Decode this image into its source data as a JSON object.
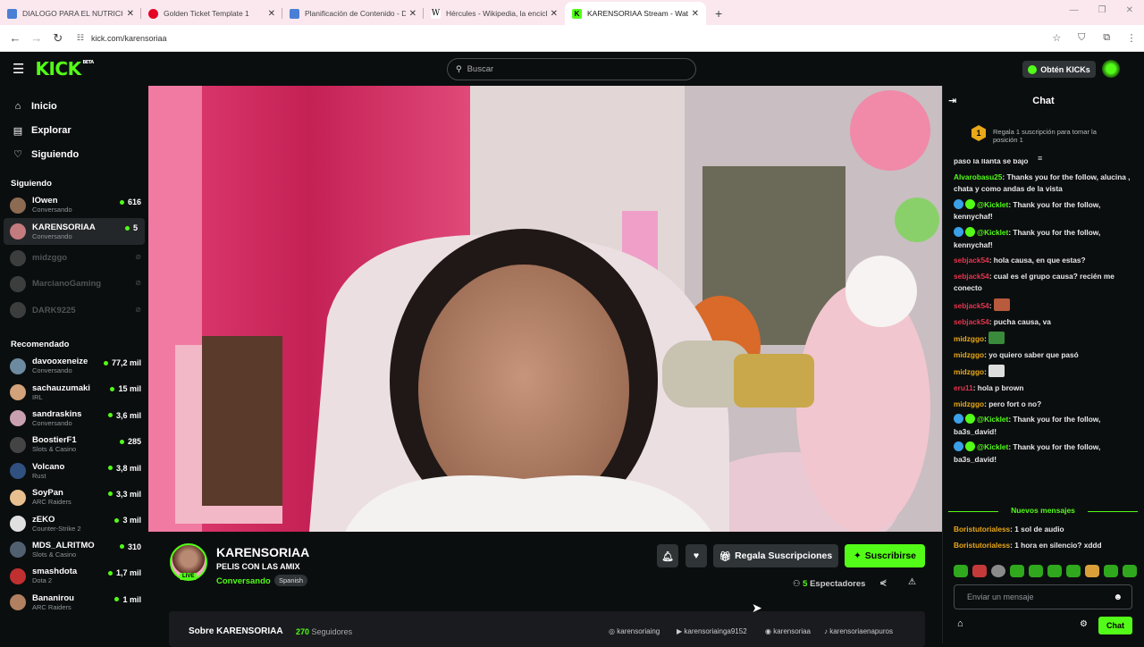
{
  "browser": {
    "tabs": [
      {
        "title": "DIALOGO PARA EL NUTRICION",
        "color": "#4a7fd6"
      },
      {
        "title": "Golden Ticket Template 1",
        "color": "#e60023"
      },
      {
        "title": "Planificación de Contenido - Di",
        "color": "#4a7fd6"
      },
      {
        "title": "Hércules - Wikipedia, la enciclo",
        "color": "#ffffff"
      },
      {
        "title": "KARENSORIAA Stream - Watch",
        "color": "#53fc18"
      }
    ],
    "url": "kick.com/karensoriaa"
  },
  "header": {
    "logo": "KICK",
    "logo_tag": "BETA",
    "search_placeholder": "Buscar",
    "get_kicks": "Obtén KICKs"
  },
  "sidebar": {
    "nav": [
      {
        "label": "Inicio"
      },
      {
        "label": "Explorar"
      },
      {
        "label": "Siguiendo"
      }
    ],
    "following_title": "Siguiendo",
    "following": [
      {
        "name": "lOwen",
        "category": "Conversando",
        "viewers": "616",
        "online": true
      },
      {
        "name": "KARENSORIAA",
        "category": "Conversando",
        "viewers": "5",
        "online": true
      },
      {
        "name": "midzggo",
        "category": "",
        "viewers": "",
        "online": false
      },
      {
        "name": "MarcianoGaming",
        "category": "",
        "viewers": "",
        "online": false
      },
      {
        "name": "DARK9225",
        "category": "",
        "viewers": "",
        "online": false
      }
    ],
    "recommended_title": "Recomendado",
    "recommended": [
      {
        "name": "davooxeneize",
        "category": "Conversando",
        "viewers": "77,2 mil"
      },
      {
        "name": "sachauzumaki",
        "category": "IRL",
        "viewers": "15 mil"
      },
      {
        "name": "sandraskins",
        "category": "Conversando",
        "viewers": "3,6 mil"
      },
      {
        "name": "BoostierF1",
        "category": "Slots & Casino",
        "viewers": "285"
      },
      {
        "name": "Volcano",
        "category": "Rust",
        "viewers": "3,8 mil"
      },
      {
        "name": "SoyPan",
        "category": "ARC Raiders",
        "viewers": "3,3 mil"
      },
      {
        "name": "zEKO",
        "category": "Counter-Strike 2",
        "viewers": "3 mil"
      },
      {
        "name": "MDS_ALRITMO",
        "category": "Slots & Casino",
        "viewers": "310"
      },
      {
        "name": "smashdota",
        "category": "Dota 2",
        "viewers": "1,7 mil"
      },
      {
        "name": "Bananirou",
        "category": "ARC Raiders",
        "viewers": "1 mil"
      }
    ]
  },
  "stream": {
    "name": "KARENSORIAA",
    "title": "PELIS CON LAS AMIX",
    "category": "Conversando",
    "language": "Spanish",
    "live": "LIVE",
    "gift_subs": "Regala Suscripciones",
    "subscribe": "Suscribirse",
    "viewers_count": "5",
    "viewers_label": "Espectadores",
    "about_title": "Sobre KARENSORIAA",
    "followers_count": "270",
    "followers_label": "Seguidores",
    "socials": [
      "karensoriaing",
      "karensoriainga9152",
      "karensoriaa",
      "karensoriaenapuros"
    ]
  },
  "chat": {
    "title": "Chat",
    "pinned": "Regala 1 suscripción para tomar la posición 1",
    "pinned_rank": "1",
    "messages": [
      {
        "user": "",
        "color": "#e8e8e8",
        "text": "paso la llanta se bajo"
      },
      {
        "user": "Alvarobasu25",
        "color": "#53fc18",
        "text": "Thanks you for the follow, alucina , chata y como andas de la vista"
      },
      {
        "user": "@Kicklet",
        "color": "#53fc18",
        "text": "Thank you for the follow, kennychaf!",
        "bot": true
      },
      {
        "user": "@Kicklet",
        "color": "#53fc18",
        "text": "Thank you for the follow, kennychaf!",
        "bot": true
      },
      {
        "user": "sebjack54",
        "color": "#e8344d",
        "text": "hola causa, en que estas?"
      },
      {
        "user": "sebjack54",
        "color": "#e8344d",
        "text": "cual es el grupo causa? recién me conecto"
      },
      {
        "user": "sebjack54",
        "color": "#e8344d",
        "text": "",
        "emote": "#b85a3c"
      },
      {
        "user": "sebjack54",
        "color": "#e8344d",
        "text": "pucha causa, va"
      },
      {
        "user": "midzggo",
        "color": "#e8a817",
        "text": "",
        "emote": "#3a8a3c"
      },
      {
        "user": "midzggo",
        "color": "#e8a817",
        "text": "yo quiero saber que pasó"
      },
      {
        "user": "midzggo",
        "color": "#e8a817",
        "text": "",
        "emote": "#dddddd"
      },
      {
        "user": "eru11",
        "color": "#e8344d",
        "text": "hola p brown"
      },
      {
        "user": "midzggo",
        "color": "#e8a817",
        "text": "pero fort o no?"
      },
      {
        "user": "@Kicklet",
        "color": "#53fc18",
        "text": "Thank you for the follow, ba3s_david!",
        "bot": true
      },
      {
        "user": "@Kicklet",
        "color": "#53fc18",
        "text": "Thank you for the follow, ba3s_david!",
        "bot": true
      }
    ],
    "new_messages": "Nuevos mensajes",
    "new": [
      {
        "user": "Boristutorialess",
        "color": "#e8a817",
        "text": "1 sol de audio"
      },
      {
        "user": "Boristutorialess",
        "color": "#e8a817",
        "text": "1 hora en silencio? xddd"
      }
    ],
    "input_placeholder": "Enviar un mensaje",
    "send": "Chat"
  }
}
